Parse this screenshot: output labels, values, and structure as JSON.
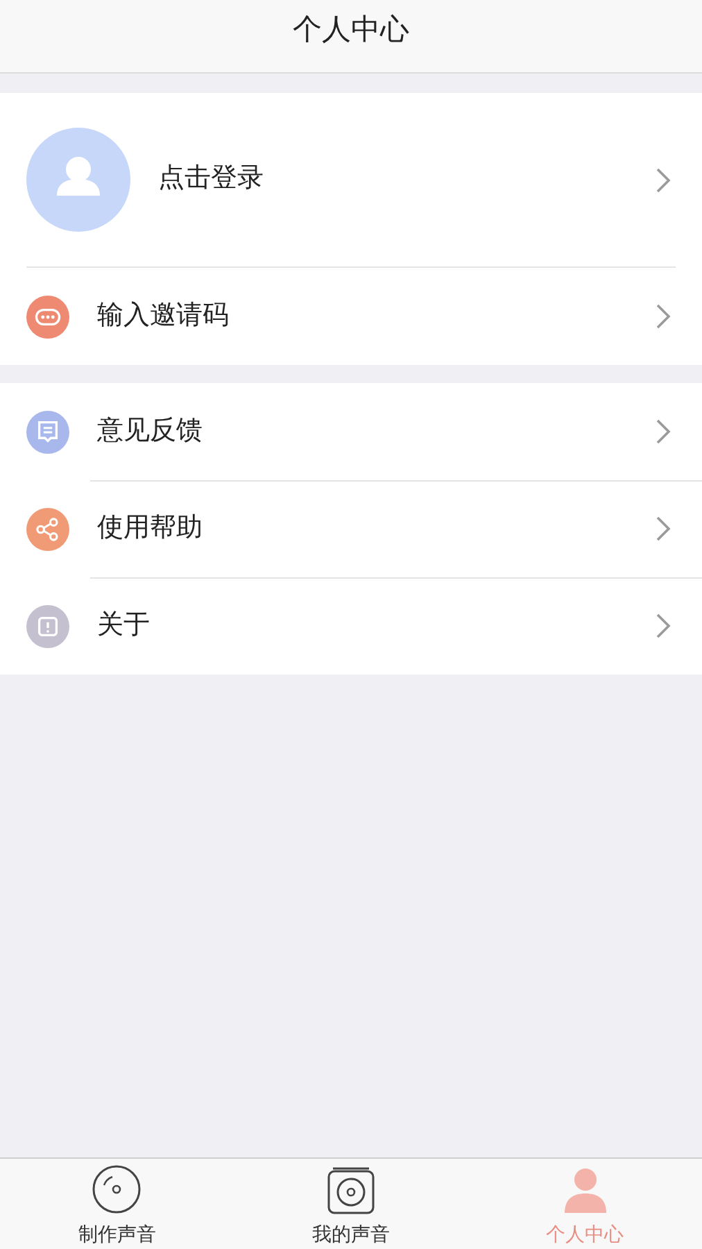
{
  "header": {
    "title": "个人中心"
  },
  "profile": {
    "label": "点击登录"
  },
  "groups": [
    {
      "items": [
        {
          "kind": "invite",
          "label": "输入邀请码",
          "color": "#ee8a72"
        }
      ]
    },
    {
      "items": [
        {
          "kind": "feedback",
          "label": "意见反馈",
          "color": "#a9b8ec"
        },
        {
          "kind": "share",
          "label": "使用帮助",
          "color": "#f19a76"
        },
        {
          "kind": "about",
          "label": "关于",
          "color": "#c4c0cf"
        }
      ]
    }
  ],
  "tab_bar": [
    {
      "kind": "disc",
      "label": "制作声音",
      "selected": false
    },
    {
      "kind": "record",
      "label": "我的声音",
      "selected": false
    },
    {
      "kind": "person",
      "label": "个人中心",
      "selected": true
    }
  ]
}
